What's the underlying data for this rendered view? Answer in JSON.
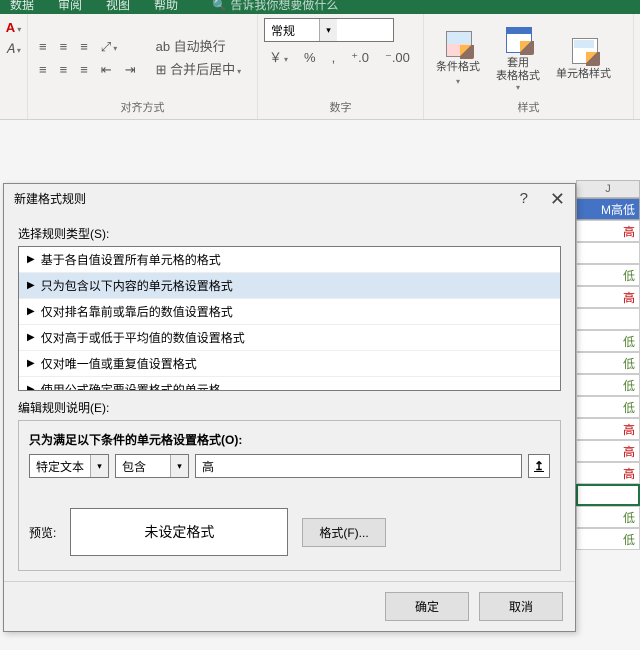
{
  "ribbon": {
    "tabs": {
      "t1": "数据",
      "t2": "审阅",
      "t3": "视图",
      "t4": "帮助"
    },
    "search": "告诉我你想要做什么",
    "font_letter": "A",
    "wrap_text": "自动换行",
    "merge_center": "合并后居中",
    "number_format": "常规",
    "cond_fmt": "条件格式",
    "table_fmt": "套用\n表格格式",
    "cell_style": "单元格样式",
    "group_align": "对齐方式",
    "group_number": "数字",
    "group_styles": "样式",
    "percent": "%",
    "comma": ",",
    "inc_dec": ".0",
    "dec_dec": ".00",
    "currency": "￥"
  },
  "grid": {
    "col_letter": "J",
    "header": "M高低",
    "rows": [
      {
        "v": "高",
        "cls": "high"
      },
      {
        "v": "",
        "cls": ""
      },
      {
        "v": "低",
        "cls": "low"
      },
      {
        "v": "高",
        "cls": "high"
      },
      {
        "v": "",
        "cls": ""
      },
      {
        "v": "低",
        "cls": "low"
      },
      {
        "v": "低",
        "cls": "low"
      },
      {
        "v": "低",
        "cls": "low"
      },
      {
        "v": "低",
        "cls": "low"
      },
      {
        "v": "高",
        "cls": "high"
      },
      {
        "v": "高",
        "cls": "high"
      },
      {
        "v": "高",
        "cls": "high"
      },
      {
        "v": "",
        "cls": "selected"
      },
      {
        "v": "低",
        "cls": "low"
      },
      {
        "v": "低",
        "cls": "low"
      }
    ]
  },
  "dialog": {
    "title": "新建格式规则",
    "help": "?",
    "select_type": "选择规则类型(S):",
    "rules": [
      "基于各自值设置所有单元格的格式",
      "只为包含以下内容的单元格设置格式",
      "仅对排名靠前或靠后的数值设置格式",
      "仅对高于或低于平均值的数值设置格式",
      "仅对唯一值或重复值设置格式",
      "使用公式确定要设置格式的单元格"
    ],
    "selected_rule_index": 1,
    "edit_desc": "编辑规则说明(E):",
    "cond_label": "只为满足以下条件的单元格设置格式(O):",
    "combo1": "特定文本",
    "combo2": "包含",
    "value": "高",
    "preview_label": "预览:",
    "preview_text": "未设定格式",
    "format_btn": "格式(F)...",
    "ok": "确定",
    "cancel": "取消"
  }
}
